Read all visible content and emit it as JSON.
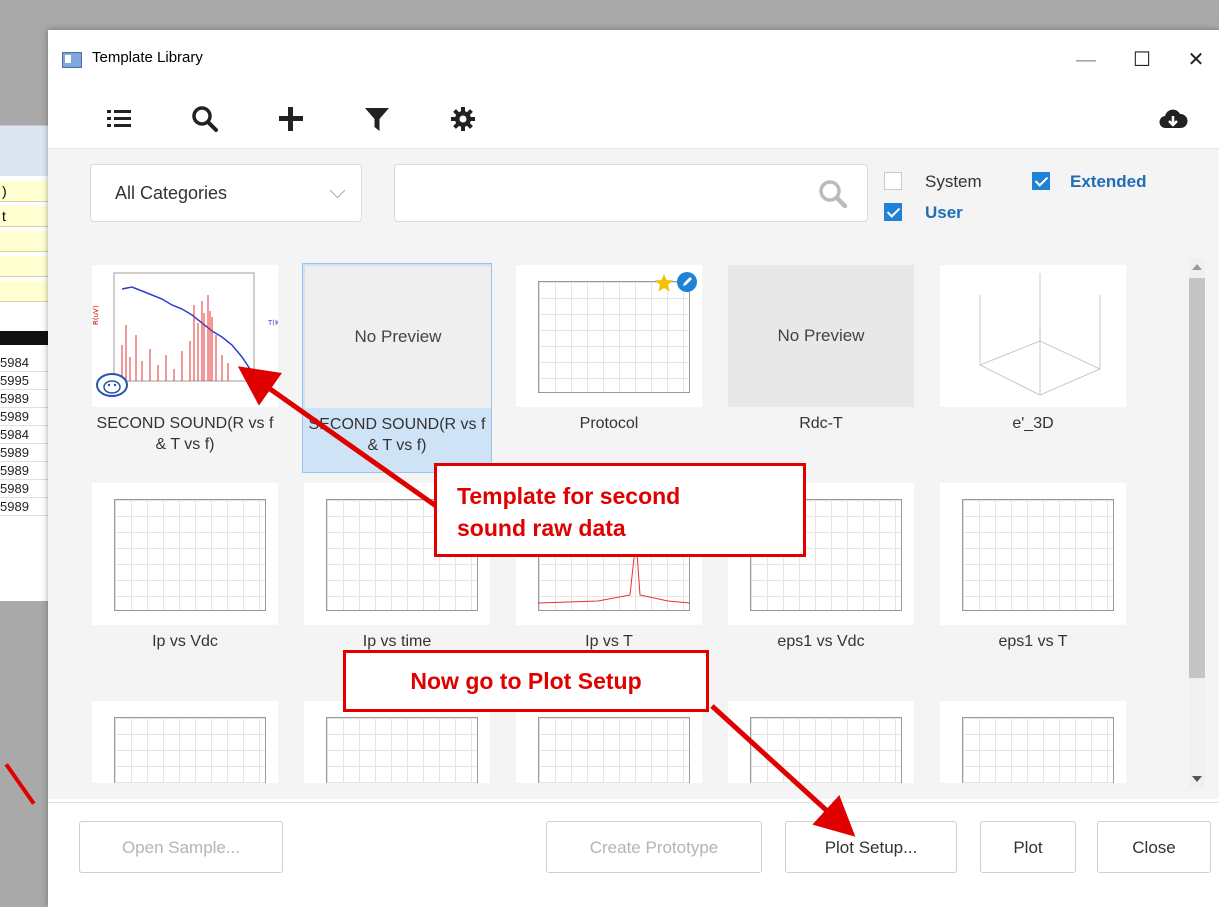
{
  "background_window": {
    "cells": [
      ")",
      "t"
    ],
    "numbers": [
      "5984",
      "5995",
      "5989",
      "5989",
      "5984",
      "5989",
      "5989",
      "5989",
      "5989"
    ]
  },
  "dialog": {
    "title": "Template Library",
    "window_controls": {
      "minimize": "—",
      "maximize": "☐",
      "close": "✕"
    }
  },
  "toolbar": {
    "icons": [
      "list-icon",
      "search-icon",
      "add-icon",
      "filter-icon",
      "settings-icon",
      "cloud-download-icon"
    ]
  },
  "filter": {
    "category": "All Categories",
    "search_placeholder": "",
    "checkboxes": [
      {
        "label": "System",
        "checked": false
      },
      {
        "label": "Extended",
        "checked": true
      },
      {
        "label": "User",
        "checked": true
      }
    ]
  },
  "templates": [
    {
      "label": "SECOND SOUND(R vs f & T vs f)",
      "preview": "chart"
    },
    {
      "label": "SECOND SOUND(R vs f & T vs f)",
      "preview": "none",
      "no_preview_text": "No Preview",
      "selected": true
    },
    {
      "label": "Protocol",
      "preview": "grid"
    },
    {
      "label": "Rdc-T",
      "preview": "none",
      "no_preview_text": "No Preview"
    },
    {
      "label": "e'_3D",
      "preview": "3d"
    },
    {
      "label": "Ip vs Vdc",
      "preview": "grid"
    },
    {
      "label": "Ip vs time",
      "preview": "grid"
    },
    {
      "label": "Ip vs T",
      "preview": "grid"
    },
    {
      "label": "eps1 vs Vdc",
      "preview": "grid"
    },
    {
      "label": "eps1 vs T",
      "preview": "grid"
    },
    {
      "label": "",
      "preview": "grid"
    },
    {
      "label": "",
      "preview": "grid"
    },
    {
      "label": "",
      "preview": "grid"
    },
    {
      "label": "",
      "preview": "grid"
    },
    {
      "label": "",
      "preview": "grid"
    }
  ],
  "footer": {
    "open_sample": "Open Sample...",
    "create_prototype": "Create Prototype",
    "plot_setup": "Plot Setup...",
    "plot": "Plot",
    "close": "Close"
  },
  "annotations": {
    "callout1_line1": "Template for second",
    "callout1_line2": "sound raw data",
    "callout2": "Now go to Plot Setup"
  },
  "colors": {
    "accent": "#1f82d6",
    "annotation_red": "#e00000",
    "selected_tile": "#cfe3f6"
  }
}
